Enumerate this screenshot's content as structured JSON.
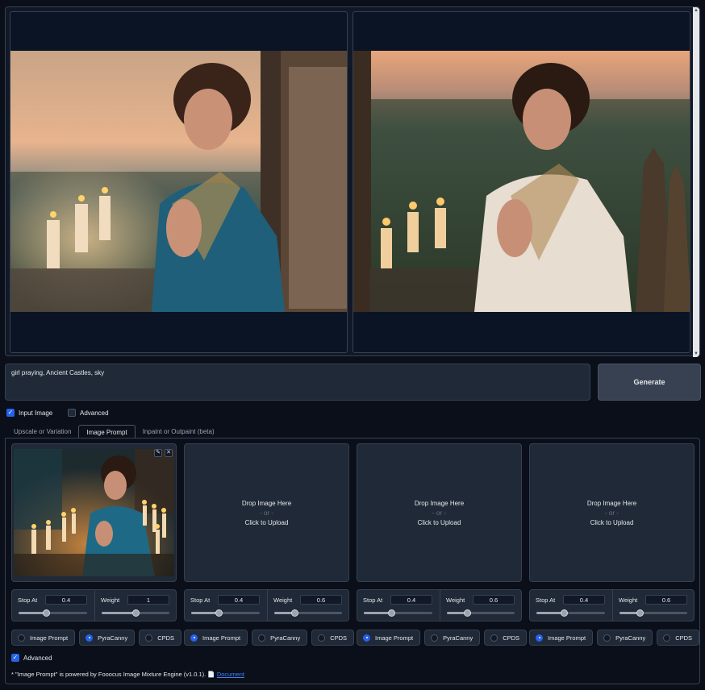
{
  "gallery": {
    "images": [
      {
        "name": "gallery-image-1",
        "alt": "generated image 1"
      },
      {
        "name": "gallery-image-2",
        "alt": "generated image 2"
      }
    ]
  },
  "prompt": {
    "value": "girl praying, Ancient Castles, sky"
  },
  "generate": {
    "label": "Generate"
  },
  "options": {
    "input_image_label": "Input Image",
    "input_image_checked": true,
    "advanced_label": "Advanced",
    "advanced_checked": false
  },
  "tabs": [
    {
      "label": "Upscale or Variation",
      "active": false
    },
    {
      "label": "Image Prompt",
      "active": true
    },
    {
      "label": "Inpaint or Outpaint (beta)",
      "active": false
    }
  ],
  "upload": {
    "drop_text": "Drop Image Here",
    "or_text": "- or -",
    "click_text": "Click to Upload"
  },
  "image_prompts": [
    {
      "stop_at_label": "Stop At",
      "stop_at": 0.4,
      "weight_label": "Weight",
      "weight": 1,
      "type": "PyraCanny"
    },
    {
      "stop_at_label": "Stop At",
      "stop_at": 0.4,
      "weight_label": "Weight",
      "weight": 0.6,
      "type": "Image Prompt"
    },
    {
      "stop_at_label": "Stop At",
      "stop_at": 0.4,
      "weight_label": "Weight",
      "weight": 0.6,
      "type": "Image Prompt"
    },
    {
      "stop_at_label": "Stop At",
      "stop_at": 0.4,
      "weight_label": "Weight",
      "weight": 0.6,
      "type": "Image Prompt"
    }
  ],
  "types": [
    "Image Prompt",
    "PyraCanny",
    "CPDS"
  ],
  "advanced_bottom": {
    "label": "Advanced",
    "checked": true
  },
  "footnote": {
    "text": "* \"Image Prompt\" is powered by Fooocus Image Mixture Engine (v1.0.1).",
    "icon": "document-icon",
    "link": "Document"
  },
  "colors": {
    "accent": "#2563eb",
    "bg": "#0b0f19",
    "panel": "#1f2937",
    "border": "#374151"
  }
}
